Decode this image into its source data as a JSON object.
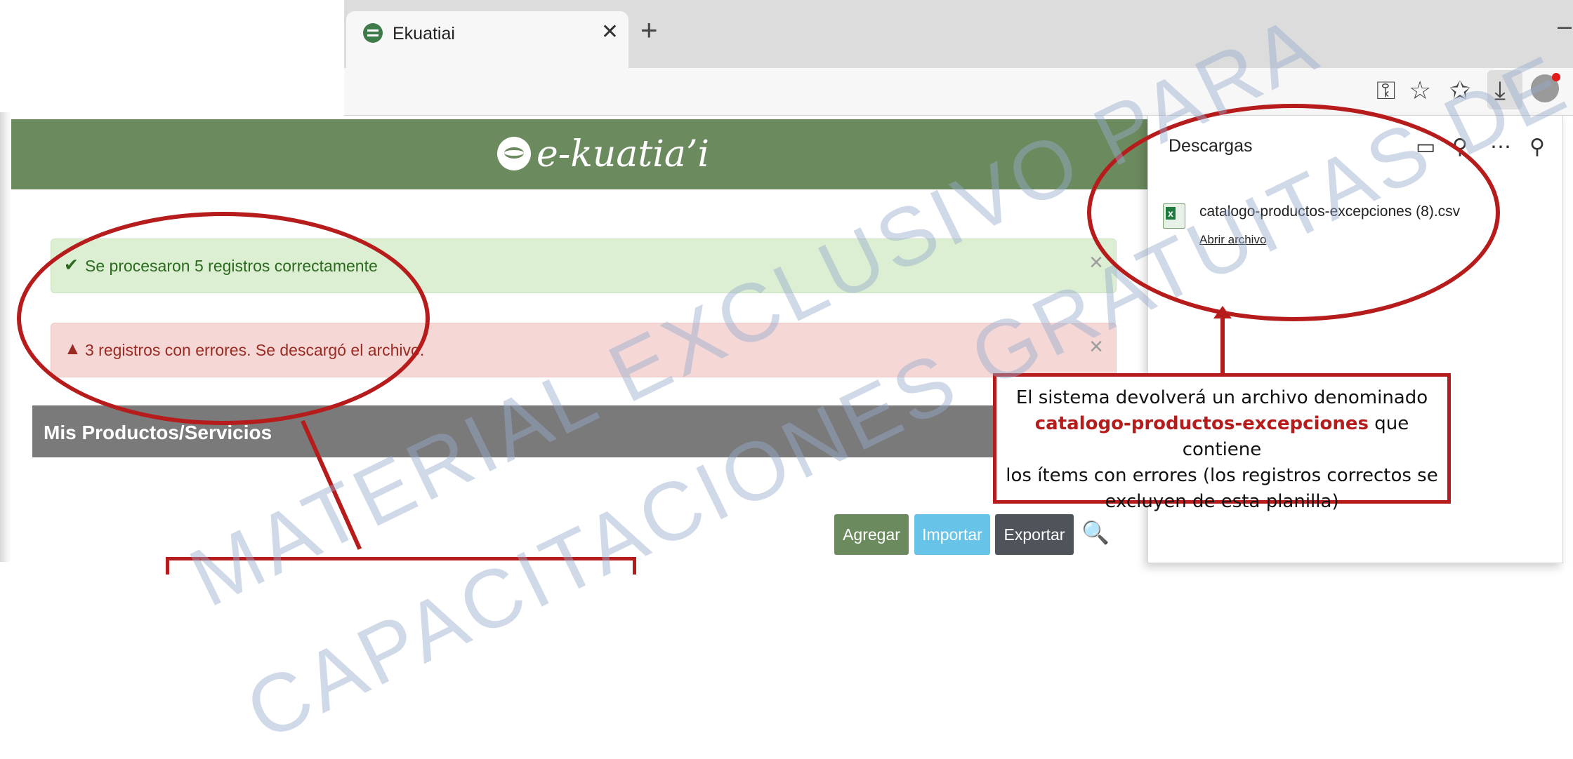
{
  "browser": {
    "tab_title": "Ekuatiai",
    "close_glyph": "✕",
    "new_tab_glyph": "+",
    "minimize_glyph": "–",
    "toolbar_icons": [
      "key-icon",
      "star-outline-icon",
      "favorites-icon",
      "download-icon",
      "profile-icon"
    ]
  },
  "header": {
    "logo_text": "e-kuatia’i"
  },
  "alerts": {
    "success": {
      "icon": "✔",
      "text": "Se procesaron 5 registros correctamente",
      "close": "×"
    },
    "danger": {
      "icon": "▲",
      "text": "3 registros con errores. Se descargó el archivo.",
      "close": "×"
    }
  },
  "panel": {
    "title": "Mis Productos/Servicios"
  },
  "actions": {
    "add": "Agregar",
    "import": "Importar",
    "export": "Exportar"
  },
  "downloads": {
    "title": "Descargas",
    "file_name": "catalogo-productos-excepciones (8).csv",
    "open_link": "Abrir archivo"
  },
  "callout": {
    "line1": "El sistema devolverá un archivo denominado",
    "highlight": "catalogo-productos-excepciones",
    "line2_rest": " que contiene",
    "line3": "los ítems con errores (los registros correctos se",
    "line4": "excluyen de esta planilla)"
  },
  "watermark": {
    "line1": "MATERIAL EXCLUSIVO PARA",
    "line2": "CAPACITACIONES GRATUITAS DE LA DNIT"
  },
  "colors": {
    "brand_green": "#6b8a5e",
    "annotation_red": "#b71c1c",
    "import_blue": "#67c3e8"
  }
}
